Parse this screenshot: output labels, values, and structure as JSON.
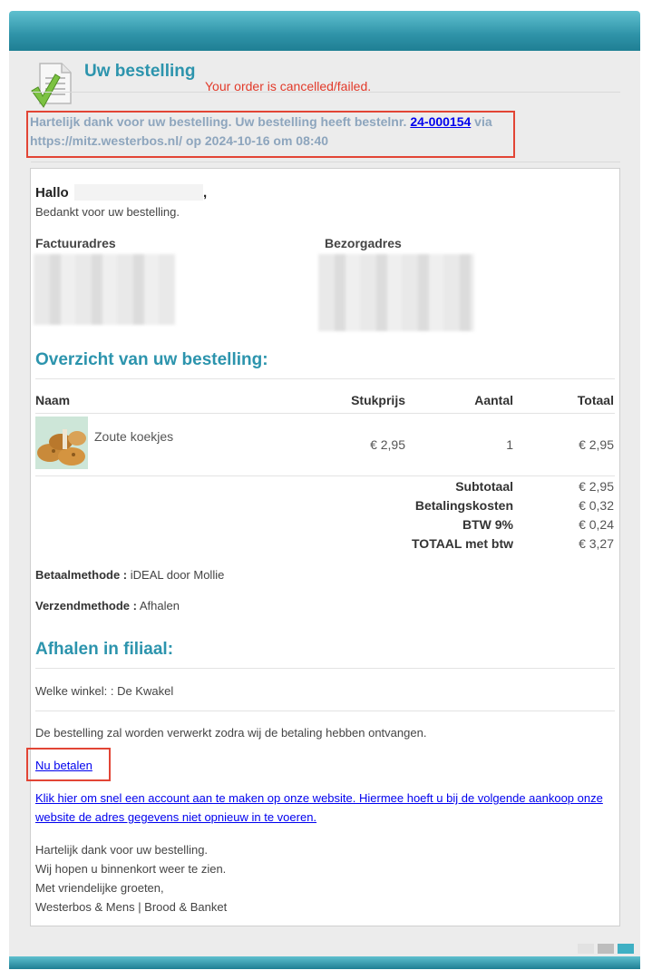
{
  "header": {
    "title": "Uw bestelling",
    "status": "Your order is cancelled/failed.",
    "doc_icon": "document-check-icon"
  },
  "intro": {
    "text_before": "Hartelijk dank voor uw bestelling. Uw bestelling heeft bestelnr.",
    "order_number": "24-000154",
    "text_after": "via https://mitz.westerbos.nl/ op 2024-10-16 om 08:40"
  },
  "greeting": {
    "hello": "Hallo",
    "comma": ",",
    "thanks": "Bedankt voor uw bestelling."
  },
  "addresses": {
    "billing_label": "Factuuradres",
    "shipping_label": "Bezorgadres"
  },
  "overview": {
    "title": "Overzicht van uw bestelling:",
    "columns": [
      "Naam",
      "Stukprijs",
      "Aantal",
      "Totaal"
    ],
    "items": [
      {
        "name": "Zoute koekjes",
        "unit_price": "€ 2,95",
        "quantity": "1",
        "total": "€ 2,95",
        "image_icon": "cookies-image"
      }
    ],
    "summary": [
      {
        "label": "Subtotaal",
        "value": "€ 2,95"
      },
      {
        "label": "Betalingskosten",
        "value": "€ 0,32"
      },
      {
        "label": "BTW 9%",
        "value": "€ 0,24"
      },
      {
        "label": "TOTAAL met btw",
        "value": "€ 3,27"
      }
    ]
  },
  "payment": {
    "label": "Betaalmethode :",
    "value": "iDEAL door Mollie"
  },
  "shipping": {
    "label": "Verzendmethode :",
    "value": "Afhalen"
  },
  "pickup": {
    "title": "Afhalen in filiaal:",
    "store": "Welke winkel: : De Kwakel"
  },
  "processing_note": "De bestelling zal worden verwerkt zodra wij de betaling hebben ontvangen.",
  "pay_now": "Nu betalen",
  "account_link": "Klik hier om snel een account aan te maken op onze website. Hiermee hoeft u bij de volgende aankoop onze website de adres gegevens niet opnieuw in te voeren.",
  "closing": [
    "Hartelijk dank voor uw bestelling.",
    "Wij hopen u binnenkort weer te zien.",
    "Met vriendelijke groeten,",
    "Westerbos & Mens | Brood & Banket"
  ],
  "colors": {
    "accent": "#2c94ad",
    "status_red": "#e23a2a",
    "link": "#0000ee"
  }
}
